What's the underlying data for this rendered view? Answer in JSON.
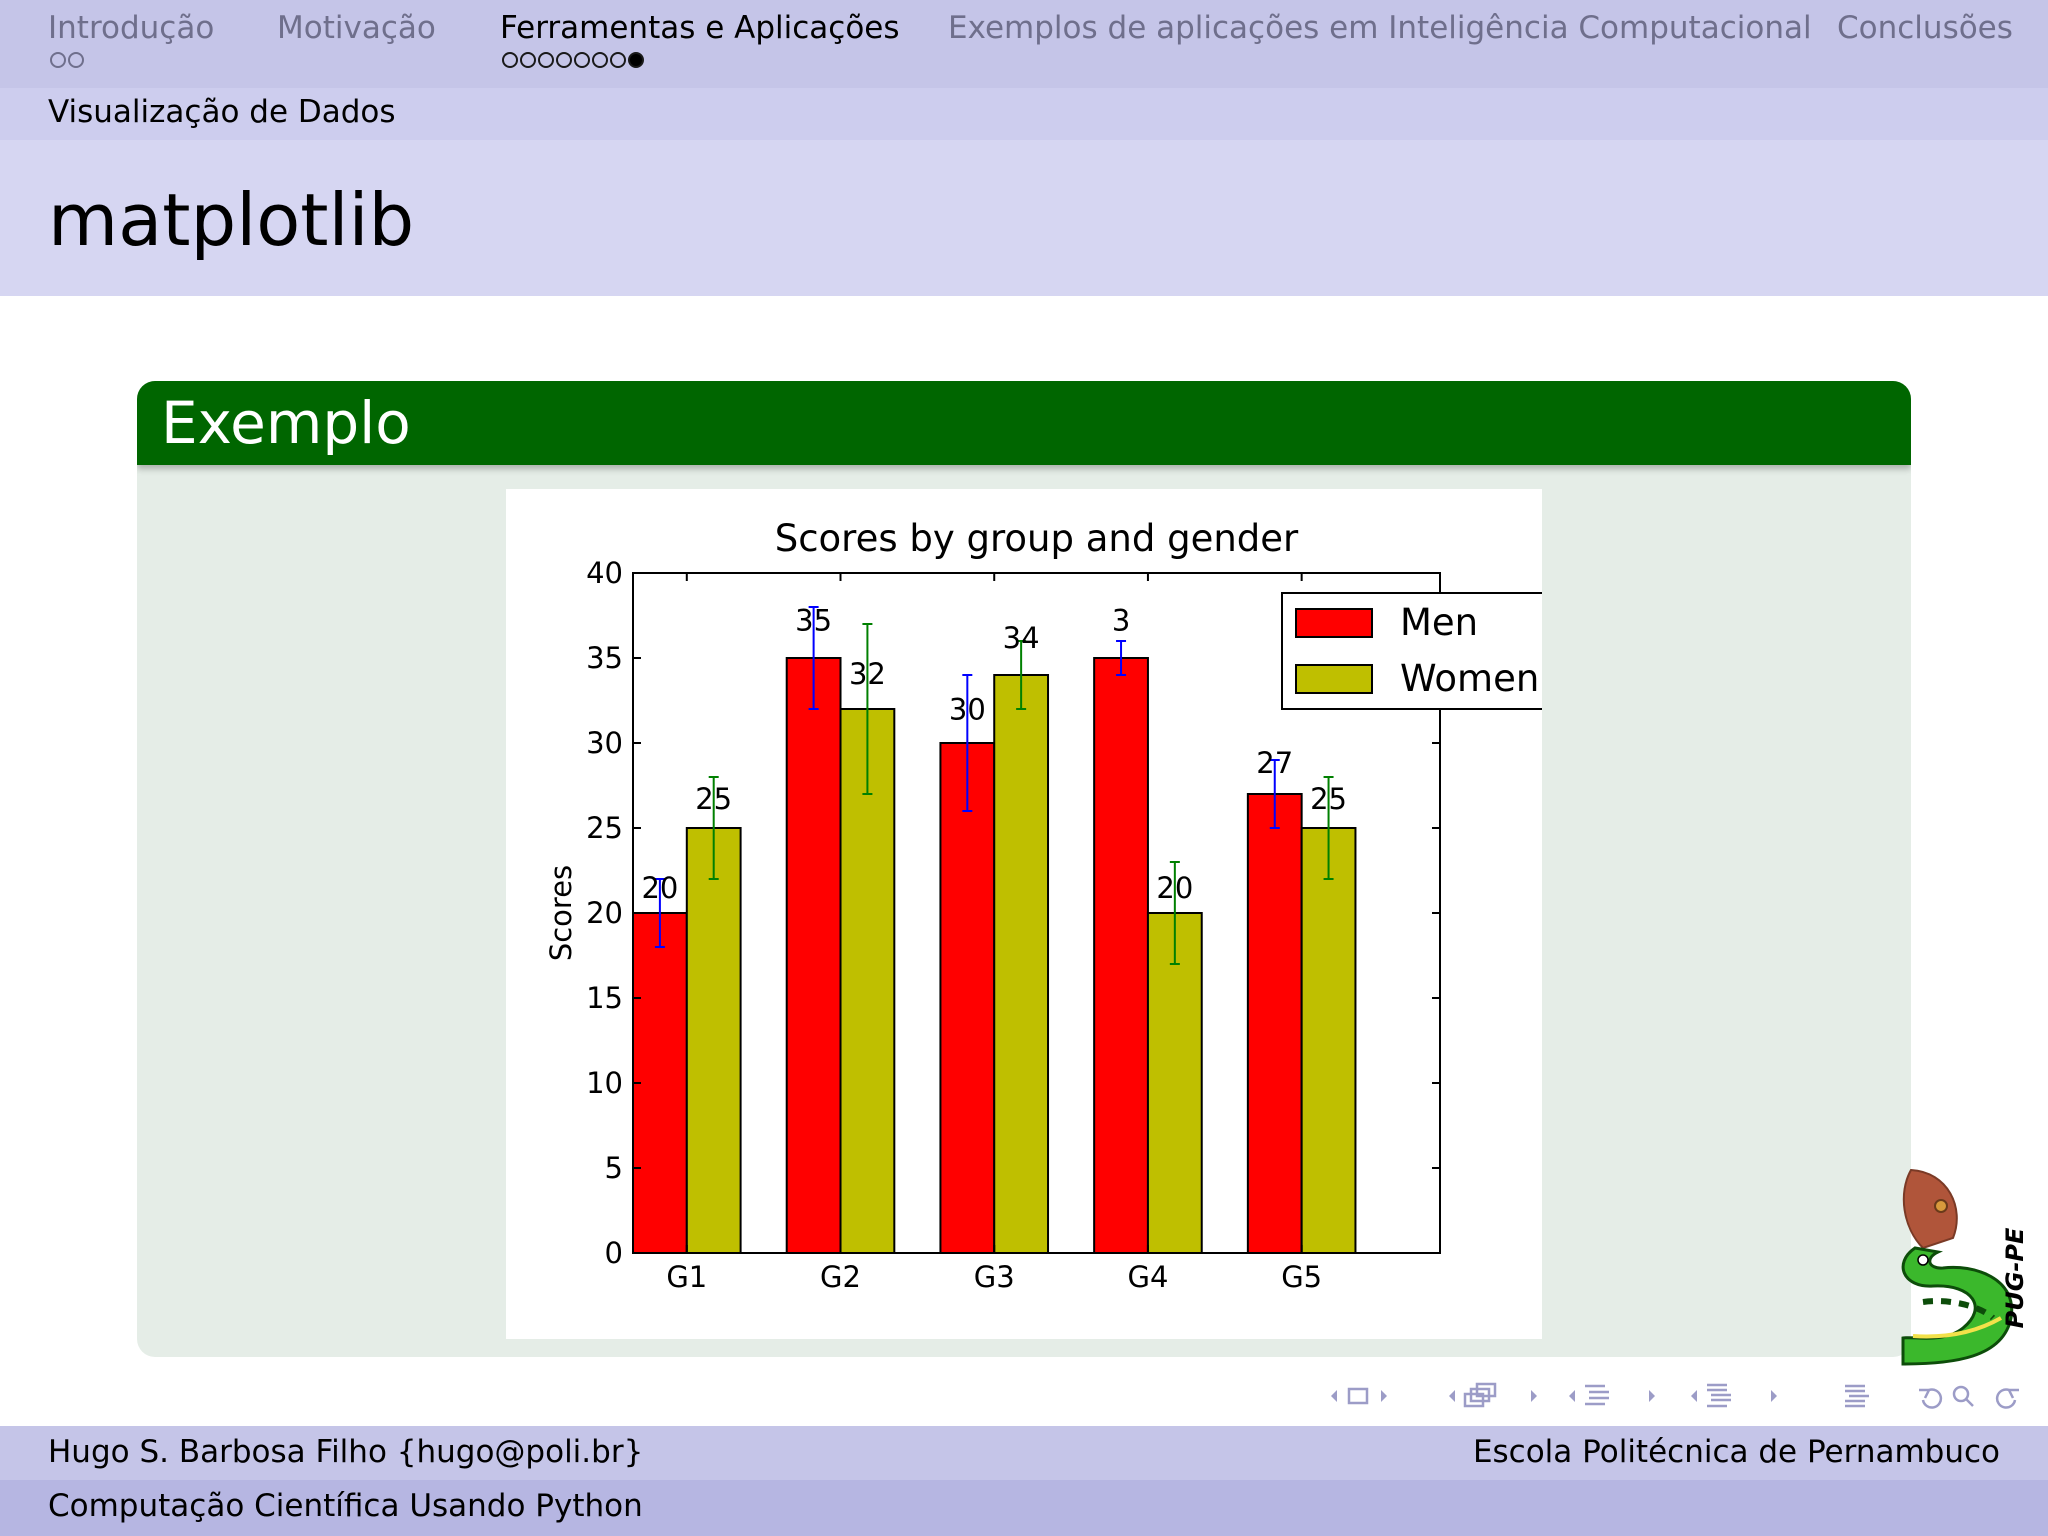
{
  "nav": {
    "sections": [
      {
        "label": "Introdução",
        "dots": 2,
        "filled": -1,
        "active": false
      },
      {
        "label": "Motivação",
        "dots": 0,
        "filled": -1,
        "active": false
      },
      {
        "label": "Ferramentas e Aplicações",
        "dots": 8,
        "filled": 7,
        "active": true
      },
      {
        "label": "Exemplos de aplicações em Inteligência Computacional",
        "dots": 0,
        "filled": -1,
        "active": false
      },
      {
        "label": "Conclusões",
        "dots": 0,
        "filled": -1,
        "active": false
      }
    ]
  },
  "subsection": "Visualização de Dados",
  "frame_title": "matplotlib",
  "block": {
    "title": "Exemplo"
  },
  "chart_data": {
    "type": "bar",
    "title": "Scores by group and gender",
    "xlabel": "",
    "ylabel": "Scores",
    "categories": [
      "G1",
      "G2",
      "G3",
      "G4",
      "G5"
    ],
    "ylim": [
      0,
      40
    ],
    "yticks": [
      0,
      5,
      10,
      15,
      20,
      25,
      30,
      35,
      40
    ],
    "grid": false,
    "legend_position": "top-right",
    "series": [
      {
        "name": "Men",
        "values": [
          20,
          35,
          30,
          35,
          27
        ],
        "errors": [
          2,
          3,
          4,
          1,
          2
        ],
        "color": "#ff0000",
        "error_color": "#0000ff"
      },
      {
        "name": "Women",
        "values": [
          25,
          32,
          34,
          20,
          25
        ],
        "errors": [
          3,
          5,
          2,
          3,
          3
        ],
        "color": "#bfbf00",
        "error_color": "#008000"
      }
    ],
    "data_labels": [
      [
        "20",
        "35",
        "30",
        "3",
        "27"
      ],
      [
        "25",
        "32",
        "34",
        "20",
        "25"
      ]
    ]
  },
  "logo": {
    "text": "PUG-PE"
  },
  "footer": {
    "author": "Hugo S. Barbosa Filho {hugo@poli.br}",
    "institution": "Escola Politécnica de Pernambuco",
    "talk_title": "Computação Científica Usando Python"
  },
  "colors": {
    "nav_bg": "#c5c5e8",
    "block_header": "#006600",
    "block_body": "#e5ede7",
    "footer_dark": "#b6b6e2"
  }
}
